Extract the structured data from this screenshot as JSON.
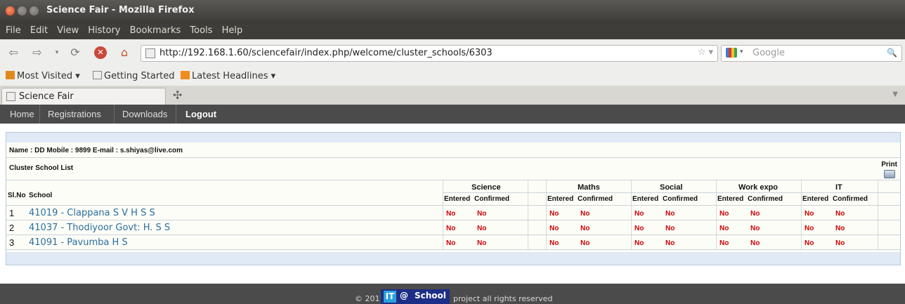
{
  "window": {
    "title": "Science Fair - Mozilla Firefox"
  },
  "menu": [
    "File",
    "Edit",
    "View",
    "History",
    "Bookmarks",
    "Tools",
    "Help"
  ],
  "url": "http://192.168.1.60/sciencefair/index.php/welcome/cluster_schools/6303",
  "search_placeholder": "Google",
  "bookmarks": [
    "Most Visited ▾",
    "Getting Started",
    "Latest Headlines ▾"
  ],
  "tab": {
    "label": "Science Fair"
  },
  "sitenav": [
    "Home",
    "Registrations",
    "Downloads",
    "Logout"
  ],
  "info": "Name : DD   Mobile : 9899   E-mail : s.shiyas@live.com",
  "cluster_title": "Cluster School List",
  "print_label": "Print",
  "table": {
    "col_slno": "Sl.No",
    "col_school": "School",
    "subjects": [
      "Science",
      "Maths",
      "Social",
      "Work expo",
      "IT"
    ],
    "sub_entered": "Entered",
    "sub_confirmed": "Confirmed",
    "rows": [
      {
        "no": "1",
        "school": "41019 -  Clappana S V H S S",
        "status": [
          "No",
          "No",
          "No",
          "No",
          "No",
          "No",
          "No",
          "No",
          "No",
          "No"
        ]
      },
      {
        "no": "2",
        "school": "41037 -  Thodiyoor Govt: H. S S",
        "status": [
          "No",
          "No",
          "No",
          "No",
          "No",
          "No",
          "No",
          "No",
          "No",
          "No"
        ]
      },
      {
        "no": "3",
        "school": "41091 -  Pavumba H S",
        "status": [
          "No",
          "No",
          "No",
          "No",
          "No",
          "No",
          "No",
          "No",
          "No",
          "No"
        ]
      }
    ]
  },
  "footer": {
    "copy": "© 2011",
    "logo_it": "IT",
    "logo_at": "@",
    "logo_school": "School",
    "rest": "project all rights reserved"
  },
  "colors": {
    "link": "#2a6f9e",
    "status_no": "#cc0000",
    "nav_bg": "#4b4b4b"
  }
}
